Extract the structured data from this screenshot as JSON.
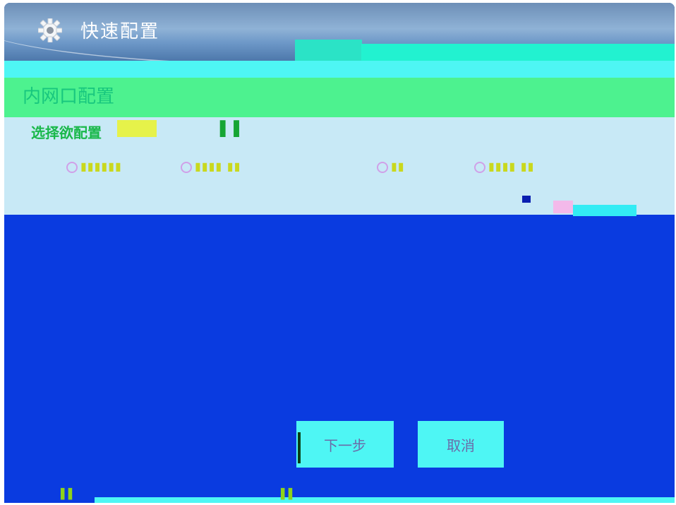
{
  "window": {
    "title": "快速配置",
    "title_icon": "gear-icon"
  },
  "section": {
    "title": "内网口配置",
    "prompt": "选择欲配置"
  },
  "colors": {
    "window_bg": "#0a3be0",
    "titlebar": "#7fa3cc",
    "band_cyan": "#4ef6f4",
    "band_green": "#4df28f",
    "band_light": "#c8e9f6",
    "section_text": "#18c77e"
  },
  "buttons": {
    "next_label": "下一步",
    "cancel_label": "取消"
  }
}
